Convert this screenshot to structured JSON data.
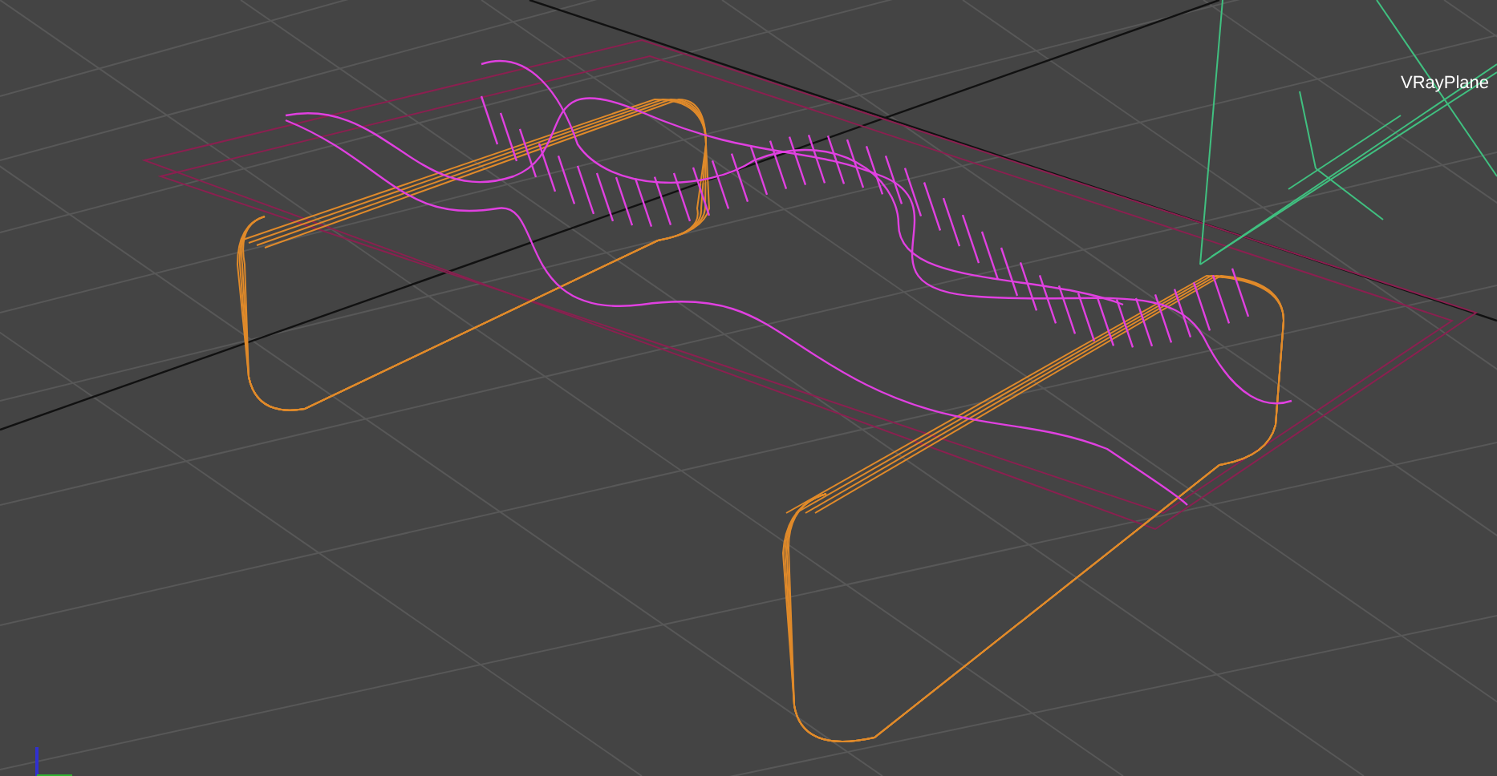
{
  "viewport": {
    "object_label": "VRayPlane"
  }
}
